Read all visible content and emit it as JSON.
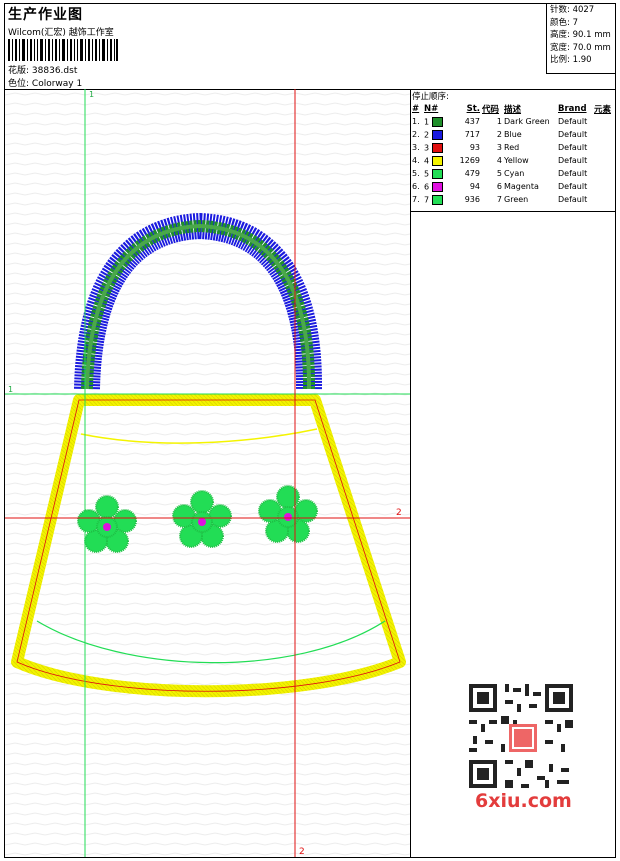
{
  "header": {
    "title": "生产作业图",
    "company": "Wilcom(汇宏) 越饰工作室",
    "design_label": "花版:",
    "design_value": "38836.dst",
    "colorway_label": "色位:",
    "colorway_value": "Colorway 1"
  },
  "specs": [
    {
      "label": "针数:",
      "value": "4027"
    },
    {
      "label": "颜色:",
      "value": "7"
    },
    {
      "label": "高度:",
      "value": "90.1 mm"
    },
    {
      "label": "宽度:",
      "value": "70.0 mm"
    },
    {
      "label": "比例:",
      "value": "1.90"
    }
  ],
  "guides": {
    "green_top": "1",
    "green_left": "1",
    "red_right": "2",
    "red_bottom": "2"
  },
  "stop_sequence": {
    "title": "停止顺序:",
    "columns": [
      "#",
      "N#",
      "St.",
      "代码",
      "描述",
      "Brand",
      "元素"
    ],
    "rows": [
      {
        "idx": "1.",
        "n": "1",
        "color": "#1f8f2a",
        "st": "437",
        "code": "1",
        "desc": "Dark Green",
        "brand": "Default"
      },
      {
        "idx": "2.",
        "n": "2",
        "color": "#1a1adf",
        "st": "717",
        "code": "2",
        "desc": "Blue",
        "brand": "Default"
      },
      {
        "idx": "3.",
        "n": "3",
        "color": "#e01010",
        "st": "93",
        "code": "3",
        "desc": "Red",
        "brand": "Default"
      },
      {
        "idx": "4.",
        "n": "4",
        "color": "#f4f400",
        "st": "1269",
        "code": "4",
        "desc": "Yellow",
        "brand": "Default"
      },
      {
        "idx": "5.",
        "n": "5",
        "color": "#22dd55",
        "st": "479",
        "code": "5",
        "desc": "Cyan",
        "brand": "Default"
      },
      {
        "idx": "6.",
        "n": "6",
        "color": "#e010e0",
        "st": "94",
        "code": "6",
        "desc": "Magenta",
        "brand": "Default"
      },
      {
        "idx": "7.",
        "n": "7",
        "color": "#22dd55",
        "st": "936",
        "code": "7",
        "desc": "Green",
        "brand": "Default"
      }
    ]
  },
  "watermark": {
    "text": "6xiu.com",
    "stamp": "刺绣图片"
  }
}
